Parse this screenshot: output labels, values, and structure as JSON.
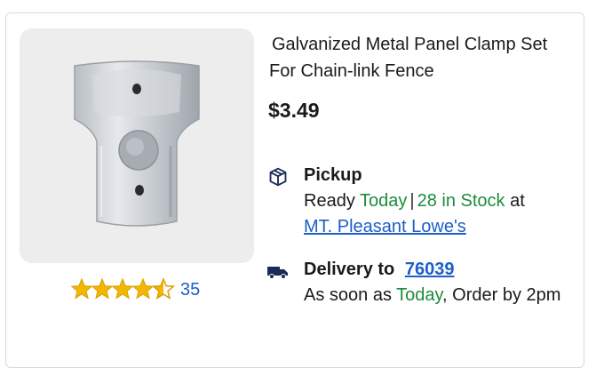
{
  "product": {
    "title": "Galvanized Metal Panel Clamp Set For Chain-link Fence",
    "price": "$3.49",
    "rating": {
      "value": 4.5,
      "max": 5,
      "count": "35"
    },
    "image_icon": "metal-clamp-product-image"
  },
  "pickup": {
    "icon": "box-pickup-icon",
    "heading": "Pickup",
    "ready_prefix": "Ready",
    "ready_day": "Today",
    "separator": "|",
    "stock": "28 in Stock",
    "at_text": "at",
    "store_link": "MT. Pleasant Lowe's"
  },
  "delivery": {
    "icon": "truck-icon",
    "heading": "Delivery to",
    "zip_link": "76039",
    "soon_prefix": "As soon as",
    "soon_day": "Today",
    "order_by": ", Order by 2pm"
  },
  "colors": {
    "green": "#1d8c3c",
    "link_blue": "#1d5ec8",
    "star_gold": "#f2b701"
  }
}
